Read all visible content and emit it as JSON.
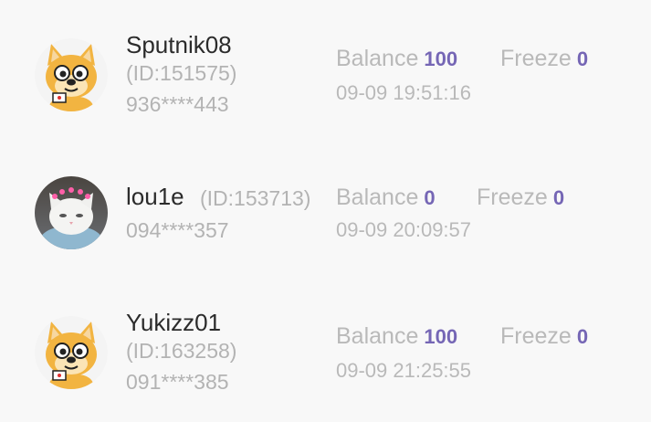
{
  "users": [
    {
      "name": "Sputnik08",
      "id": "(ID:151575)",
      "phone": "936****443",
      "balance_label": "Balance",
      "balance": "100",
      "freeze_label": "Freeze",
      "freeze": "0",
      "time": "09-09 19:51:16",
      "avatar": "doge-cartoon-avatar"
    },
    {
      "name": "lou1e",
      "id": "(ID:153713)",
      "phone": "094****357",
      "balance_label": "Balance",
      "balance": "0",
      "freeze_label": "Freeze",
      "freeze": "0",
      "time": "09-09 20:09:57",
      "avatar": "white-cat-photo-avatar"
    },
    {
      "name": "Yukizz01",
      "id": "(ID:163258)",
      "phone": "091****385",
      "balance_label": "Balance",
      "balance": "100",
      "freeze_label": "Freeze",
      "freeze": "0",
      "time": "09-09 21:25:55",
      "avatar": "doge-cartoon-avatar"
    }
  ],
  "colors": {
    "background": "#f8f8f8",
    "name": "#2b2b2b",
    "muted": "#b3b3b3",
    "accent": "#7566b5"
  }
}
